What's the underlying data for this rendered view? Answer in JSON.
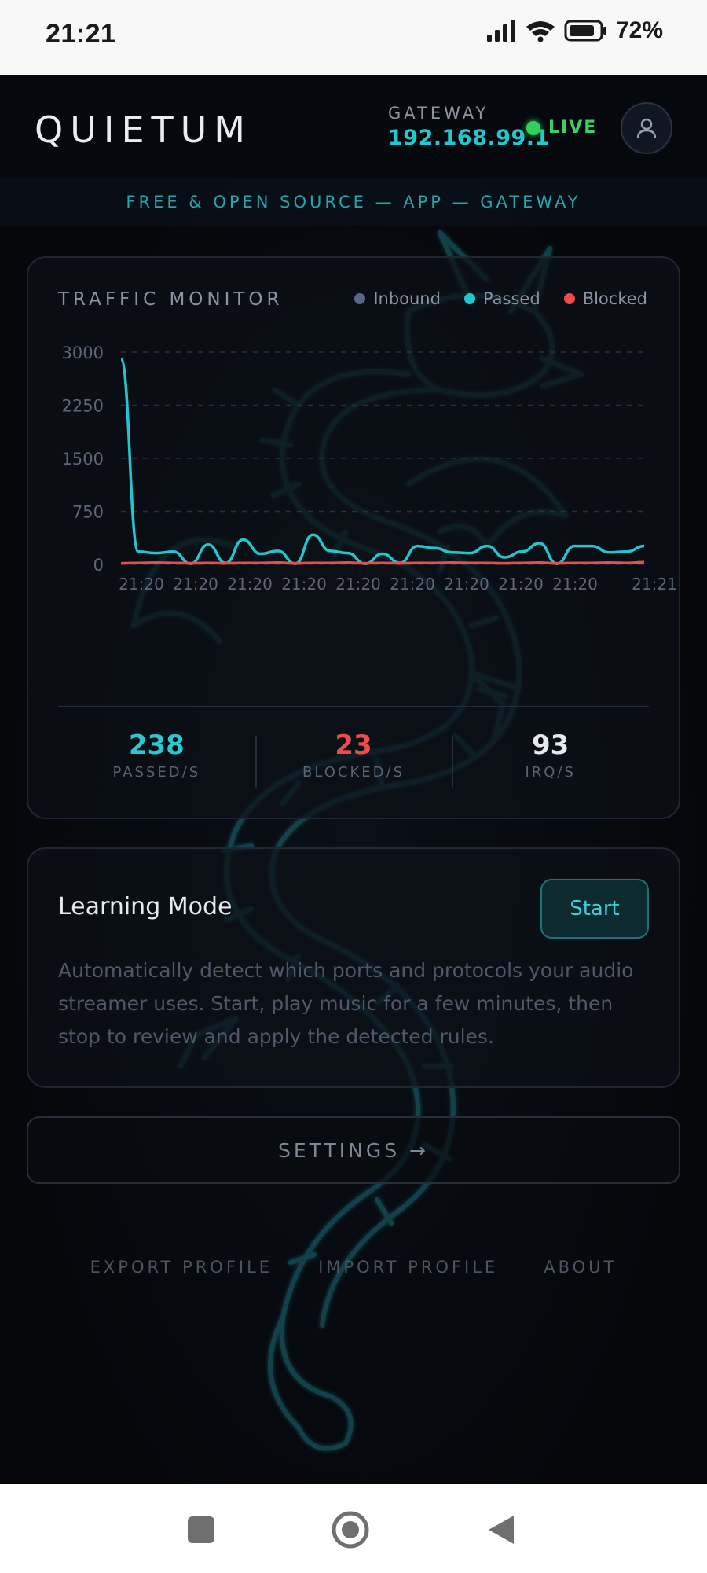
{
  "status_bar": {
    "time": "21:21",
    "battery_pct": "72%",
    "icons": [
      "signal-icon",
      "wifi-icon",
      "battery-icon"
    ]
  },
  "header": {
    "brand": "QUIETUM",
    "gateway_label": "GATEWAY",
    "gateway_ip": "192.168.99.1",
    "live_label": "LIVE"
  },
  "banner": "FREE & OPEN SOURCE — APP — GATEWAY",
  "traffic": {
    "title": "TRAFFIC MONITOR",
    "legend": [
      {
        "label": "Inbound",
        "color": "#5a6488"
      },
      {
        "label": "Passed",
        "color": "#22c6cf"
      },
      {
        "label": "Blocked",
        "color": "#ee4c4c"
      }
    ],
    "stats": [
      {
        "value": "238",
        "label": "PASSED/S",
        "color": "#2ec7cf"
      },
      {
        "value": "23",
        "label": "BLOCKED/S",
        "color": "#ee4c4c"
      },
      {
        "value": "93",
        "label": "IRQ/S",
        "color": "#e6eaf0"
      }
    ]
  },
  "chart_data": {
    "type": "line",
    "ylim": [
      0,
      3000
    ],
    "y_ticks": [
      "3000",
      "2250",
      "1500",
      "750",
      "0"
    ],
    "x_tick_labels": [
      "21:20",
      "21:20",
      "21:20",
      "21:20",
      "21:20",
      "21:20",
      "21:20",
      "21:20",
      "21:20",
      "21:21"
    ],
    "grid": true,
    "legend_position": "top-right",
    "series": [
      {
        "name": "Passed",
        "color": "#22c6cf",
        "values": [
          2900,
          180,
          160,
          180,
          10,
          280,
          20,
          350,
          150,
          190,
          10,
          420,
          190,
          160,
          10,
          150,
          20,
          260,
          230,
          170,
          160,
          260,
          100,
          180,
          300,
          10,
          260,
          260,
          170,
          180,
          260
        ]
      },
      {
        "name": "Blocked",
        "color": "#ee4c4c",
        "values": [
          15,
          20,
          25,
          20,
          15,
          20,
          15,
          20,
          20,
          25,
          15,
          20,
          20,
          25,
          15,
          20,
          15,
          20,
          20,
          25,
          20,
          20,
          15,
          20,
          25,
          15,
          20,
          20,
          25,
          20,
          30
        ]
      }
    ]
  },
  "learning": {
    "title": "Learning Mode",
    "button": "Start",
    "description": "Automatically detect which ports and protocols your audio streamer uses. Start, play music for a few minutes, then stop to review and apply the detected rules."
  },
  "settings_label": "SETTINGS →",
  "footer": {
    "export": "EXPORT PROFILE",
    "import": "IMPORT PROFILE",
    "about": "ABOUT"
  },
  "nav": [
    "recents-button",
    "home-button",
    "back-button"
  ]
}
